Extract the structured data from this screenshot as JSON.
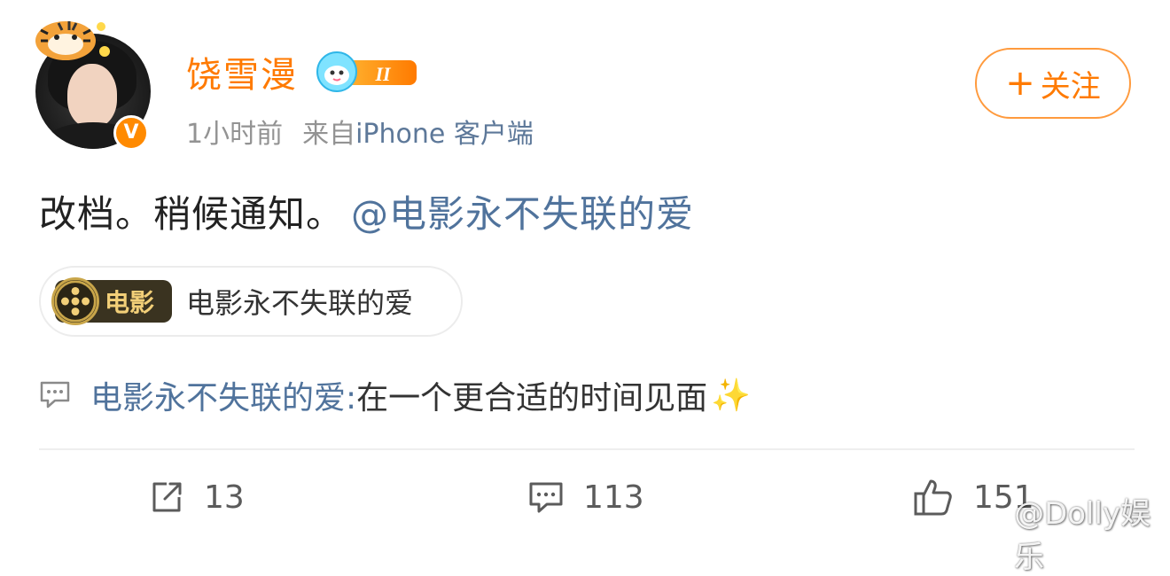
{
  "user": {
    "name": "饶雪漫",
    "level_badge": "II",
    "verified_badge": "V",
    "avatar_icon": "user-avatar",
    "pendant_icon": "tiger-pendant-icon"
  },
  "post": {
    "time": "1小时前",
    "source_prefix": "来自",
    "source_client": "iPhone 客户端",
    "text": "改档。稍候通知。",
    "mention": "@电影永不失联的爱"
  },
  "follow_button": {
    "plus": "+",
    "label": "关注"
  },
  "movie_card": {
    "tag": "电影",
    "title": "电影永不失联的爱",
    "icon": "film-reel-icon"
  },
  "topic": {
    "icon": "comment-icon",
    "name": "电影永不失联的爱:",
    "text": " 在一个更合适的时间见面",
    "emoji": "✨"
  },
  "actions": {
    "repost_count": "13",
    "comment_count": "113",
    "like_count": "151"
  },
  "watermark": "@Dolly娱乐",
  "colors": {
    "accent_orange": "#ff7a00",
    "link_blue": "#50739c",
    "meta_gray": "#939393"
  }
}
